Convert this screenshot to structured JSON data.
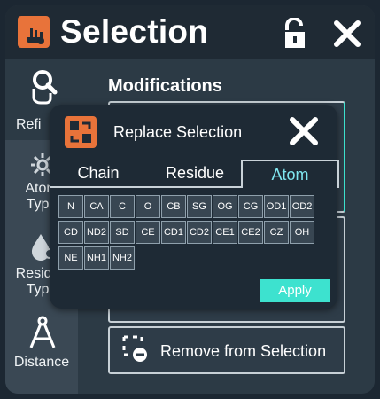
{
  "header": {
    "title": "Selection"
  },
  "sidebar": {
    "items": [
      {
        "label": "Refi",
        "icon": "magnifier-hand-icon"
      },
      {
        "label_lines": [
          "Atom",
          "Type"
        ],
        "icon": "atom-gear-icon"
      },
      {
        "label_lines": [
          "Residue",
          "Type"
        ],
        "icon": "droplet-gear-icon"
      },
      {
        "label": "Distance",
        "icon": "compass-icon"
      }
    ]
  },
  "main": {
    "modifications_label": "Modifications",
    "remove_label": "Remove from Selection"
  },
  "dialog": {
    "title": "Replace Selection",
    "tabs": [
      {
        "label": "Chain",
        "active": false
      },
      {
        "label": "Residue",
        "active": false
      },
      {
        "label": "Atom",
        "active": true
      }
    ],
    "atoms": [
      [
        "N",
        "CA",
        "C",
        "O",
        "CB",
        "SG",
        "OG",
        "CG",
        "OD1",
        "OD2"
      ],
      [
        "CD",
        "ND2",
        "SD",
        "CE",
        "CD1",
        "CD2",
        "CE1",
        "CE2",
        "CZ",
        "OH"
      ],
      [
        "NE",
        "NH1",
        "NH2"
      ]
    ],
    "apply_label": "Apply"
  },
  "colors": {
    "accent_orange": "#e8733a",
    "accent_cyan": "#3de2cf",
    "active_tab_text": "#7fe7f0"
  }
}
